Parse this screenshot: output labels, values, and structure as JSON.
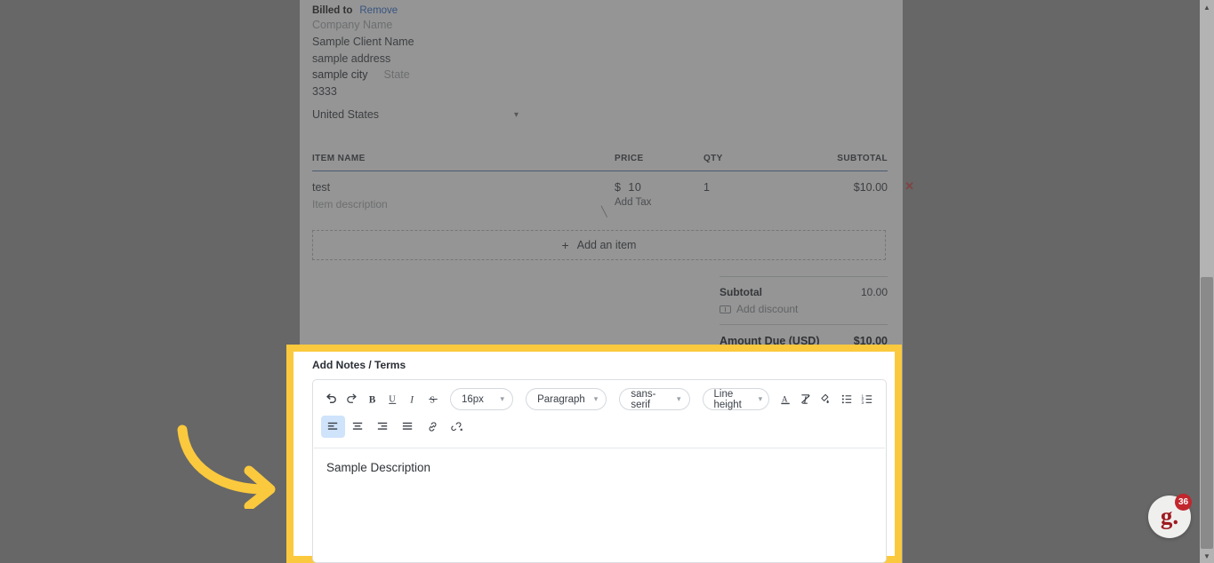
{
  "invoice": {
    "billed_to": {
      "label": "Billed to",
      "remove_label": "Remove",
      "company_placeholder": "Company Name",
      "client_name": "Sample Client Name",
      "address": "sample address",
      "city": "sample city",
      "state_placeholder": "State",
      "zip": "3333",
      "country": "United States"
    },
    "table": {
      "headers": [
        "ITEM NAME",
        "PRICE",
        "QTY",
        "SUBTOTAL"
      ],
      "rows": [
        {
          "name": "test",
          "description_placeholder": "Item description",
          "price_symbol": "$",
          "price": "10",
          "add_tax_label": "Add Tax",
          "qty": "1",
          "subtotal": "$10.00",
          "remove_icon": "close-x-icon"
        }
      ],
      "add_item_label": "Add an item",
      "add_item_icon": "plus-icon"
    },
    "totals": {
      "subtotal_label": "Subtotal",
      "subtotal_value": "10.00",
      "add_discount_label": "Add discount",
      "add_discount_icon": "tag-icon",
      "amount_due_label": "Amount Due (USD)",
      "amount_due_value": "$10.00"
    }
  },
  "notes_editor": {
    "section_label": "Add Notes / Terms",
    "toolbar_row1": [
      {
        "name": "undo-icon",
        "title": "Undo"
      },
      {
        "name": "redo-icon",
        "title": "Redo"
      },
      {
        "name": "bold-icon",
        "title": "Bold"
      },
      {
        "name": "underline-icon",
        "title": "Underline"
      },
      {
        "name": "italic-icon",
        "title": "Italic"
      },
      {
        "name": "strikethrough-icon",
        "title": "Strikethrough"
      }
    ],
    "selects": {
      "font_size": "16px",
      "block_format": "Paragraph",
      "font_family": "sans-serif",
      "line_height": "Line height"
    },
    "toolbar_row1_right": [
      {
        "name": "font-color-icon",
        "title": "Font color"
      },
      {
        "name": "clear-format-icon",
        "title": "Clear formatting"
      },
      {
        "name": "highlight-color-icon",
        "title": "Highlight color"
      },
      {
        "name": "bullet-list-icon",
        "title": "Bulleted list"
      },
      {
        "name": "numbered-list-icon",
        "title": "Numbered list"
      }
    ],
    "toolbar_row2": [
      {
        "name": "align-left-icon",
        "title": "Align left",
        "active": true
      },
      {
        "name": "align-center-icon",
        "title": "Align center",
        "active": false
      },
      {
        "name": "align-right-icon",
        "title": "Align right",
        "active": false
      },
      {
        "name": "align-justify-icon",
        "title": "Justify",
        "active": false
      },
      {
        "name": "link-icon",
        "title": "Insert link",
        "active": false
      },
      {
        "name": "unlink-icon",
        "title": "Remove link",
        "active": false
      }
    ],
    "body_text": "Sample Description"
  },
  "widget": {
    "logo_text": "g.",
    "badge_count": "36"
  },
  "colors": {
    "highlight_yellow": "#fbc93d",
    "arrow_yellow": "#fbc93d",
    "link_blue": "#2f6fd0",
    "remove_red": "#d04a4a",
    "badge_red": "#c1272d",
    "table_rule": "#5a7fb0"
  }
}
